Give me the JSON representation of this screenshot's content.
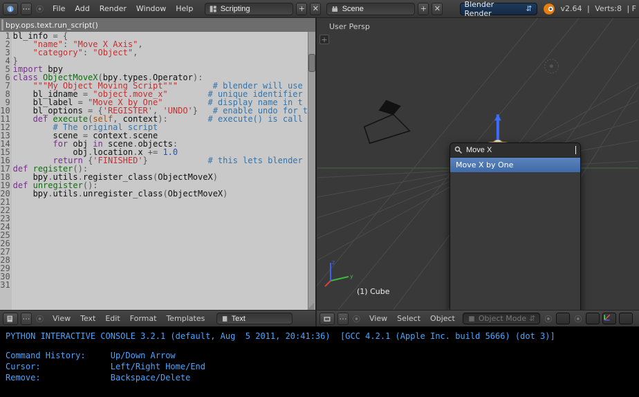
{
  "topbar": {
    "menus": [
      "File",
      "Add",
      "Render",
      "Window",
      "Help"
    ],
    "layout_selector": "Scripting",
    "scene_selector": "Scene",
    "renderer": "Blender Render",
    "version": "v2.64",
    "stats": "Verts:8"
  },
  "editor": {
    "top_command": "bpy.ops.text.run_script()",
    "textblock_name": "Text",
    "bottom_menus": [
      "View",
      "Text",
      "Edit",
      "Format",
      "Templates"
    ],
    "lines": [
      {
        "n": 1,
        "segs": [
          [
            "",
            "bl_info "
          ],
          [
            "op",
            "= {"
          ]
        ]
      },
      {
        "n": 2,
        "segs": [
          [
            "",
            "    "
          ],
          [
            "str",
            "\"name\""
          ],
          [
            "op",
            ": "
          ],
          [
            "str",
            "\"Move X Axis\""
          ],
          [
            "op",
            ","
          ]
        ]
      },
      {
        "n": 3,
        "segs": [
          [
            "",
            "    "
          ],
          [
            "str",
            "\"category\""
          ],
          [
            "op",
            ": "
          ],
          [
            "str",
            "\"Object\""
          ],
          [
            "op",
            ","
          ]
        ]
      },
      {
        "n": 4,
        "segs": [
          [
            "op",
            "}"
          ]
        ]
      },
      {
        "n": 5,
        "segs": [
          [
            "",
            ""
          ]
        ]
      },
      {
        "n": 6,
        "segs": [
          [
            "kw",
            "import"
          ],
          [
            "",
            " bpy"
          ]
        ]
      },
      {
        "n": 7,
        "segs": [
          [
            "",
            ""
          ]
        ]
      },
      {
        "n": 8,
        "segs": [
          [
            "",
            ""
          ]
        ]
      },
      {
        "n": 9,
        "segs": [
          [
            "kw",
            "class"
          ],
          [
            "",
            " "
          ],
          [
            "cls",
            "ObjectMoveX"
          ],
          [
            "op",
            "("
          ],
          [
            "",
            "bpy"
          ],
          [
            "op",
            "."
          ],
          [
            "",
            "types"
          ],
          [
            "op",
            "."
          ],
          [
            "",
            "Operator"
          ],
          [
            "op",
            ")"
          ],
          [
            "op",
            ":"
          ]
        ]
      },
      {
        "n": 10,
        "segs": [
          [
            "",
            "    "
          ],
          [
            "str",
            "\"\"\"My Object Moving Script\"\"\""
          ],
          [
            "",
            "       "
          ],
          [
            "cmt",
            "# blender will use"
          ]
        ]
      },
      {
        "n": 11,
        "segs": [
          [
            "",
            "    bl_idname "
          ],
          [
            "op",
            "= "
          ],
          [
            "str",
            "\"object.move_x\""
          ],
          [
            "",
            "        "
          ],
          [
            "cmt",
            "# unique identifier"
          ]
        ]
      },
      {
        "n": 12,
        "segs": [
          [
            "",
            "    bl_label "
          ],
          [
            "op",
            "= "
          ],
          [
            "str",
            "\"Move X by One\""
          ],
          [
            "",
            "         "
          ],
          [
            "cmt",
            "# display name in t"
          ]
        ]
      },
      {
        "n": 13,
        "segs": [
          [
            "",
            "    bl_options "
          ],
          [
            "op",
            "= {"
          ],
          [
            "str",
            "'REGISTER'"
          ],
          [
            "op",
            ", "
          ],
          [
            "str",
            "'UNDO'"
          ],
          [
            "op",
            "}"
          ],
          [
            "",
            "   "
          ],
          [
            "cmt",
            "# enable undo for t"
          ]
        ]
      },
      {
        "n": 14,
        "segs": [
          [
            "",
            ""
          ]
        ]
      },
      {
        "n": 15,
        "segs": [
          [
            "",
            "    "
          ],
          [
            "kw",
            "def"
          ],
          [
            "",
            " "
          ],
          [
            "cls",
            "execute"
          ],
          [
            "op",
            "("
          ],
          [
            "caps",
            "self"
          ],
          [
            "op",
            ", "
          ],
          [
            "",
            "context"
          ],
          [
            "op",
            ")"
          ],
          [
            "op",
            ":"
          ],
          [
            "",
            "        "
          ],
          [
            "cmt",
            "# execute() is call"
          ]
        ]
      },
      {
        "n": 16,
        "segs": [
          [
            "",
            ""
          ]
        ]
      },
      {
        "n": 17,
        "segs": [
          [
            "",
            "        "
          ],
          [
            "cmt",
            "# The original script"
          ]
        ]
      },
      {
        "n": 18,
        "segs": [
          [
            "",
            "        scene "
          ],
          [
            "op",
            "= "
          ],
          [
            "",
            "context"
          ],
          [
            "op",
            "."
          ],
          [
            "",
            "scene"
          ]
        ]
      },
      {
        "n": 19,
        "segs": [
          [
            "",
            "        "
          ],
          [
            "kw",
            "for"
          ],
          [
            "",
            " obj "
          ],
          [
            "kw",
            "in"
          ],
          [
            "",
            " scene"
          ],
          [
            "op",
            "."
          ],
          [
            "",
            "objects"
          ],
          [
            "op",
            ":"
          ]
        ]
      },
      {
        "n": 20,
        "segs": [
          [
            "",
            "            obj"
          ],
          [
            "op",
            "."
          ],
          [
            "",
            "location"
          ],
          [
            "op",
            "."
          ],
          [
            "",
            "x "
          ],
          [
            "op",
            "+= "
          ],
          [
            "num",
            "1.0"
          ]
        ]
      },
      {
        "n": 21,
        "segs": [
          [
            "",
            ""
          ]
        ]
      },
      {
        "n": 22,
        "segs": [
          [
            "",
            "        "
          ],
          [
            "kw",
            "return"
          ],
          [
            "",
            " "
          ],
          [
            "op",
            "{"
          ],
          [
            "str",
            "'FINISHED'"
          ],
          [
            "op",
            "}"
          ],
          [
            "",
            "            "
          ],
          [
            "cmt",
            "# this lets blender"
          ]
        ]
      },
      {
        "n": 23,
        "segs": [
          [
            "",
            ""
          ]
        ]
      },
      {
        "n": 24,
        "segs": [
          [
            "kw",
            "def"
          ],
          [
            "",
            " "
          ],
          [
            "cls",
            "register"
          ],
          [
            "op",
            "()"
          ],
          [
            "op",
            ":"
          ]
        ]
      },
      {
        "n": 25,
        "segs": [
          [
            "",
            "    bpy"
          ],
          [
            "op",
            "."
          ],
          [
            "",
            "utils"
          ],
          [
            "op",
            "."
          ],
          [
            "",
            "register_class"
          ],
          [
            "op",
            "("
          ],
          [
            "",
            "ObjectMoveX"
          ],
          [
            "op",
            ")"
          ]
        ]
      },
      {
        "n": 26,
        "segs": [
          [
            "",
            ""
          ]
        ]
      },
      {
        "n": 27,
        "segs": [
          [
            "",
            ""
          ]
        ]
      },
      {
        "n": 28,
        "segs": [
          [
            "kw",
            "def"
          ],
          [
            "",
            " "
          ],
          [
            "cls",
            "unregister"
          ],
          [
            "op",
            "()"
          ],
          [
            "op",
            ":"
          ]
        ]
      },
      {
        "n": 29,
        "segs": [
          [
            "",
            "    bpy"
          ],
          [
            "op",
            "."
          ],
          [
            "",
            "utils"
          ],
          [
            "op",
            "."
          ],
          [
            "",
            "unregister_class"
          ],
          [
            "op",
            "("
          ],
          [
            "",
            "ObjectMoveX"
          ],
          [
            "op",
            ")"
          ]
        ]
      },
      {
        "n": 30,
        "segs": []
      },
      {
        "n": 31,
        "segs": []
      }
    ]
  },
  "viewport": {
    "perspective_label": "User Persp",
    "active_object": "(1) Cube",
    "search_placeholder": "",
    "search_value": "Move X",
    "search_result": "Move X by One",
    "bottom_menus": [
      "View",
      "Select",
      "Object"
    ],
    "mode": "Object Mode"
  },
  "console": {
    "line1": "PYTHON INTERACTIVE CONSOLE 3.2.1 (default, Aug  5 2011, 20:41:36)  [GCC 4.2.1 (Apple Inc. build 5666) (dot 3)]",
    "h1_l": "Command History:",
    "h1_r": "Up/Down Arrow",
    "h2_l": "Cursor:",
    "h2_r": "Left/Right Home/End",
    "h3_l": "Remove:",
    "h3_r": "Backspace/Delete"
  }
}
